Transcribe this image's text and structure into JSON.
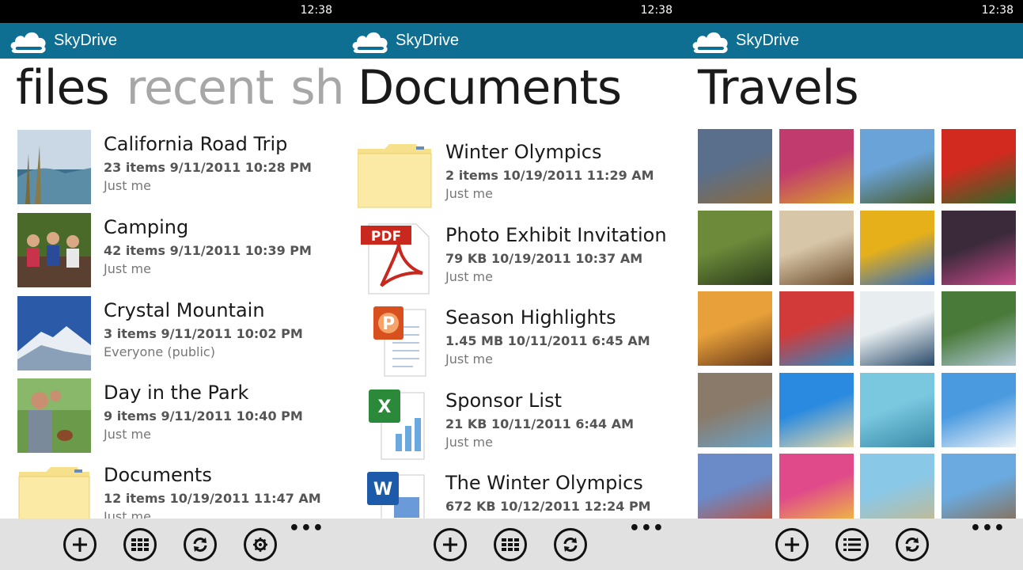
{
  "status_bar": {
    "time": "12:38"
  },
  "app": {
    "name": "SkyDrive"
  },
  "screen1": {
    "pivots": [
      "files",
      "recent",
      "sha"
    ],
    "items": [
      {
        "title": "California Road Trip",
        "meta": "23 items  9/11/2011 10:28 PM",
        "sharing": "Just me"
      },
      {
        "title": "Camping",
        "meta": "42 items  9/11/2011 10:39 PM",
        "sharing": "Just me"
      },
      {
        "title": "Crystal Mountain",
        "meta": "3 items  9/11/2011 10:02 PM",
        "sharing": "Everyone (public)"
      },
      {
        "title": "Day in the Park",
        "meta": "9 items  9/11/2011 10:40 PM",
        "sharing": "Just me"
      },
      {
        "title": "Documents",
        "meta": "12 items  10/19/2011 11:47 AM",
        "sharing": "Just me"
      }
    ],
    "app_bar": [
      "add-icon",
      "grid-view-icon",
      "sync-icon",
      "settings-icon"
    ]
  },
  "screen2": {
    "title": "Documents",
    "items": [
      {
        "title": "Winter Olympics",
        "meta": "2 items  10/19/2011 11:29 AM",
        "sharing": "Just me",
        "icon": "folder-icon"
      },
      {
        "title": "Photo Exhibit Invitation",
        "meta": "79 KB  10/19/2011 10:37 AM",
        "sharing": "Just me",
        "icon": "pdf-icon"
      },
      {
        "title": "Season Highlights",
        "meta": "1.45 MB  10/11/2011 6:45 AM",
        "sharing": "Just me",
        "icon": "powerpoint-icon"
      },
      {
        "title": "Sponsor List",
        "meta": "21 KB  10/11/2011 6:44 AM",
        "sharing": "Just me",
        "icon": "excel-icon"
      },
      {
        "title": "The Winter Olympics",
        "meta": "672 KB  10/12/2011 12:24 PM",
        "sharing": "",
        "icon": "word-icon"
      }
    ],
    "pdf_label": "PDF",
    "app_bar": [
      "add-icon",
      "grid-view-icon",
      "sync-icon"
    ]
  },
  "screen3": {
    "title": "Travels",
    "photos": [
      {
        "a": "#5a6f8c",
        "b": "#8a6a3e"
      },
      {
        "a": "#c23b6e",
        "b": "#d8a12a"
      },
      {
        "a": "#6aa3d8",
        "b": "#4a5a2a"
      },
      {
        "a": "#d22a1e",
        "b": "#2a6a2a"
      },
      {
        "a": "#6c8a3a",
        "b": "#2a3a1a"
      },
      {
        "a": "#d8c6a8",
        "b": "#6a4a2a"
      },
      {
        "a": "#e6b01a",
        "b": "#2a6ac8"
      },
      {
        "a": "#3a2a3a",
        "b": "#c84a8a"
      },
      {
        "a": "#e8a13a",
        "b": "#6a3a1a"
      },
      {
        "a": "#d23a3a",
        "b": "#2a8ac8"
      },
      {
        "a": "#e8eef0",
        "b": "#2a4a6a"
      },
      {
        "a": "#4a7a3a",
        "b": "#b0c8d8"
      },
      {
        "a": "#8a7a6a",
        "b": "#6aa3c8"
      },
      {
        "a": "#2a8ae0",
        "b": "#e8d8a8"
      },
      {
        "a": "#7ac8e0",
        "b": "#3a8aa8"
      },
      {
        "a": "#4a9ae0",
        "b": "#e8f0f8"
      },
      {
        "a": "#6a8ac8",
        "b": "#c84a2a"
      },
      {
        "a": "#e04a8a",
        "b": "#f0c83a"
      },
      {
        "a": "#8ac8e8",
        "b": "#c8b88a"
      },
      {
        "a": "#6aaae0",
        "b": "#8a6a4a"
      }
    ],
    "app_bar": [
      "add-icon",
      "list-view-icon",
      "sync-icon"
    ]
  },
  "more_label": "•••",
  "colors": {
    "accent": "#0f6f92",
    "status_bar": "#000000",
    "app_bar": "#e1e1e1"
  }
}
